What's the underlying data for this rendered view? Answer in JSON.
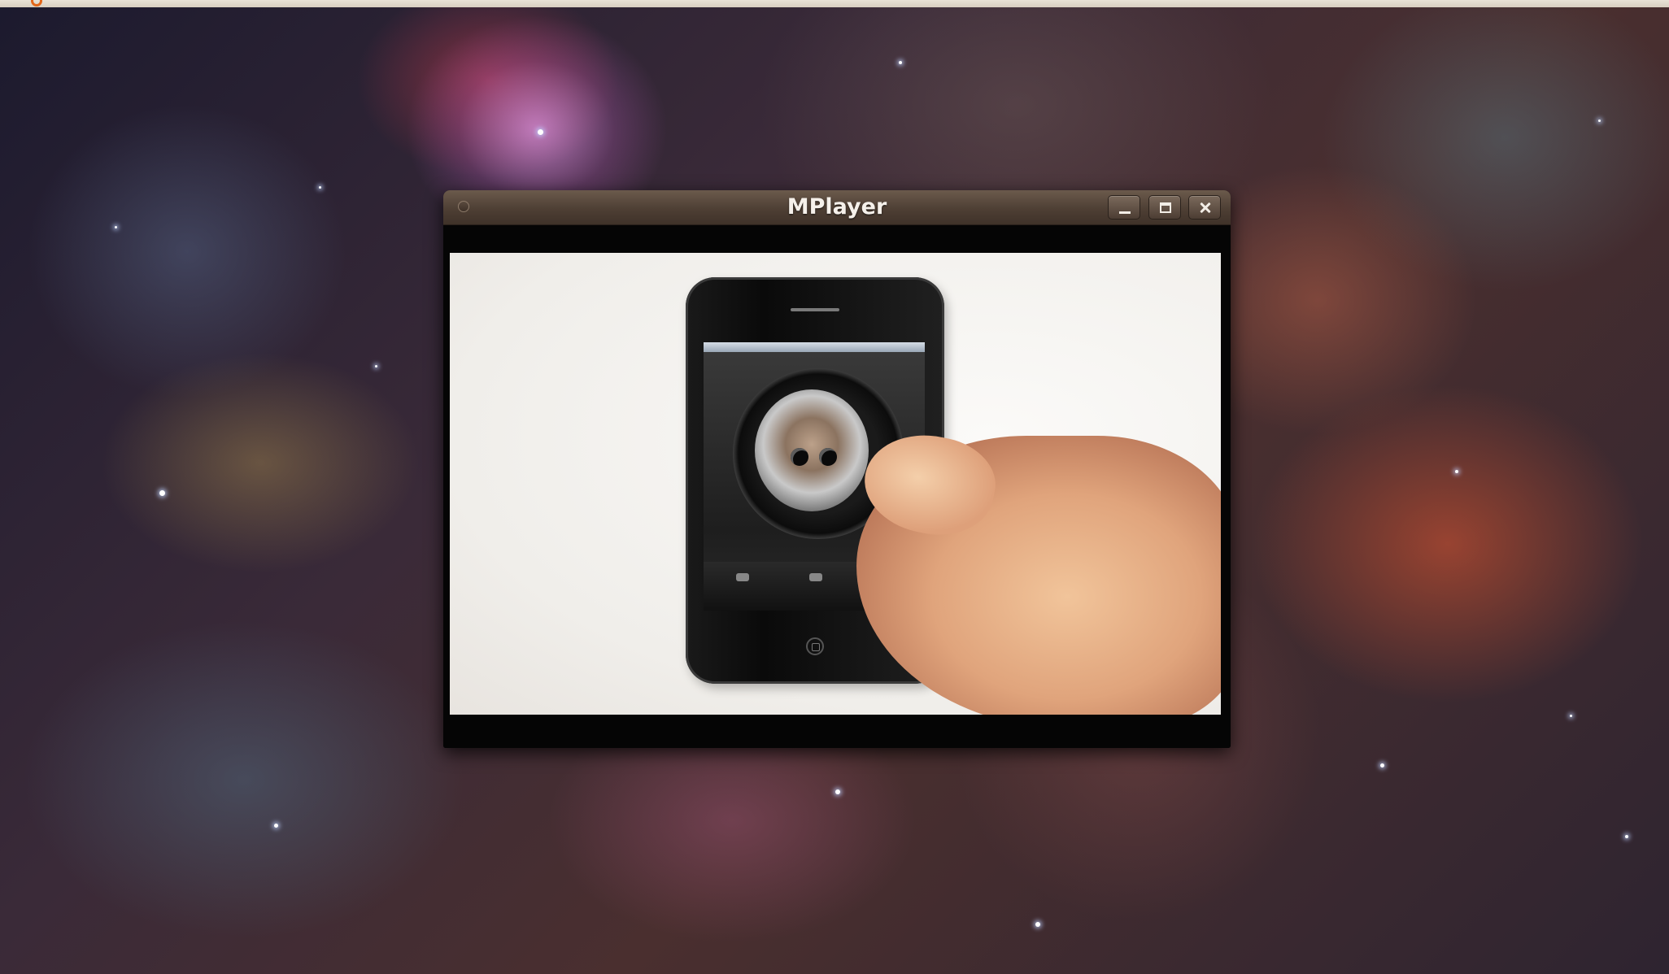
{
  "desktop": {
    "wallpaper": "orion-nebula",
    "top_panel_icon": "ubuntu-logo-icon"
  },
  "window": {
    "title": "MPlayer",
    "buttons": {
      "minimize_icon": "minimize-icon",
      "maximize_icon": "maximize-icon",
      "close_icon": "close-icon"
    },
    "menu_icon": "window-menu-icon"
  },
  "video": {
    "content": "video-frame"
  },
  "colors": {
    "titlebar": "#4e3f34",
    "title_text": "#f5f0ea",
    "video_background": "#050505"
  }
}
